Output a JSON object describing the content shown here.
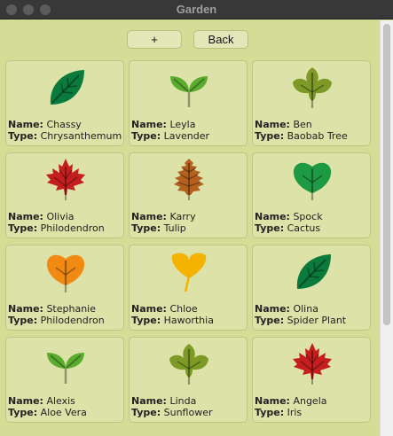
{
  "window": {
    "title": "Garden"
  },
  "toolbar": {
    "add_label": "+",
    "back_label": "Back"
  },
  "labels": {
    "name": "Name:",
    "type": "Type:"
  },
  "plants": [
    {
      "name": "Chassy",
      "type": "Chrysanthemum",
      "icon": "simple-leaf-icon",
      "color": "#0a7b3c"
    },
    {
      "name": "Leyla",
      "type": "Lavender",
      "icon": "sprout-icon",
      "color": "#5aab2e"
    },
    {
      "name": "Ben",
      "type": "Baobab Tree",
      "icon": "lobed-leaf-icon",
      "color": "#7d9a27"
    },
    {
      "name": "Olivia",
      "type": "Philodendron",
      "icon": "maple-leaf-icon",
      "color": "#c41e1e"
    },
    {
      "name": "Karry",
      "type": "Tulip",
      "icon": "oak-leaf-icon",
      "color": "#b4601e"
    },
    {
      "name": "Spock",
      "type": "Cactus",
      "icon": "heart-leaf-icon",
      "color": "#1f9a44"
    },
    {
      "name": "Stephanie",
      "type": "Philodendron",
      "icon": "heart-leaf-icon",
      "color": "#f08a12"
    },
    {
      "name": "Chloe",
      "type": "Haworthia",
      "icon": "ginkgo-leaf-icon",
      "color": "#f5b301"
    },
    {
      "name": "Olina",
      "type": "Spider Plant",
      "icon": "simple-leaf-icon",
      "color": "#0a7b3c"
    },
    {
      "name": "Alexis",
      "type": "Aloe Vera",
      "icon": "sprout-icon",
      "color": "#5aab2e"
    },
    {
      "name": "Linda",
      "type": "Sunflower",
      "icon": "lobed-leaf-icon",
      "color": "#7d9a27"
    },
    {
      "name": "Angela",
      "type": "Iris",
      "icon": "maple-leaf-icon",
      "color": "#c41e1e"
    }
  ]
}
